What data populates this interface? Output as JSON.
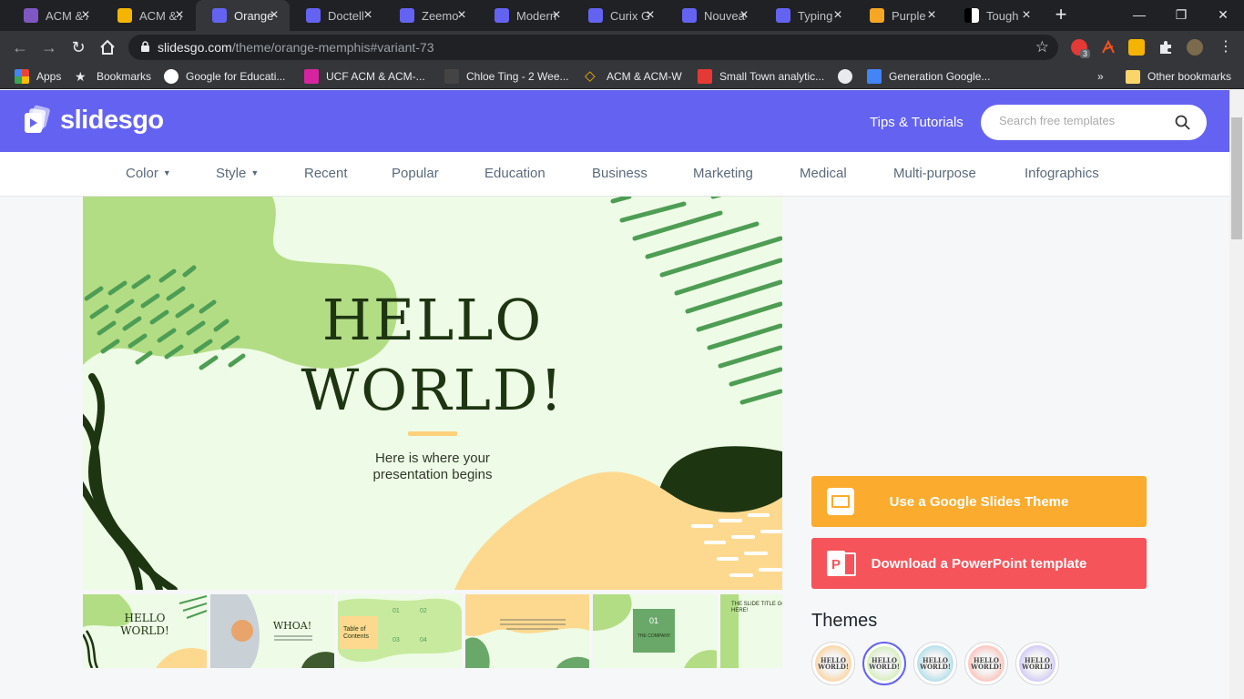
{
  "browser": {
    "tabs": [
      {
        "label": "ACM & ACM-W",
        "icon": "google-forms-icon",
        "color": "#7e57c2"
      },
      {
        "label": "ACM & ACM-W",
        "icon": "google-slides-icon",
        "color": "#f4b400"
      },
      {
        "label": "Orange Memphis",
        "icon": "slidesgo-icon",
        "color": "#6463f1",
        "active": true
      },
      {
        "label": "Doctell",
        "icon": "slidesgo-icon",
        "color": "#6463f1"
      },
      {
        "label": "Zeemo",
        "icon": "slidesgo-icon",
        "color": "#6463f1"
      },
      {
        "label": "Modern",
        "icon": "slidesgo-icon",
        "color": "#6463f1"
      },
      {
        "label": "Curix G",
        "icon": "slidesgo-icon",
        "color": "#6463f1"
      },
      {
        "label": "Nouveau",
        "icon": "slidesgo-icon",
        "color": "#6463f1"
      },
      {
        "label": "Typing",
        "icon": "slidesgo-icon",
        "color": "#6463f1"
      },
      {
        "label": "Purple",
        "icon": "orange-square-icon",
        "color": "#f6a623"
      },
      {
        "label": "Tough",
        "icon": "black-white-icon",
        "color": "#ffffff"
      }
    ],
    "url_host": "slidesgo.com",
    "url_path": "/theme/orange-memphis#variant-73",
    "bookmarks": [
      {
        "label": "Apps",
        "icon": "apps-grid-icon"
      },
      {
        "label": "Bookmarks",
        "icon": "star-icon"
      },
      {
        "label": "Google for Educati...",
        "icon": "google-icon"
      },
      {
        "label": "UCF ACM & ACM-...",
        "icon": "instagram-icon"
      },
      {
        "label": "Chloe Ting - 2 Wee...",
        "icon": "profile-icon"
      },
      {
        "label": "ACM & ACM-W",
        "icon": "diamond-icon"
      },
      {
        "label": "Small Town analytic...",
        "icon": "store-icon"
      },
      {
        "label": "",
        "icon": "globe-icon"
      },
      {
        "label": "Generation Google...",
        "icon": "google-docs-icon"
      }
    ],
    "bookmarks_more": "»",
    "other_bookmarks": "Other bookmarks",
    "extension_badge": "3"
  },
  "site": {
    "logo": "slidesgo",
    "tips": "Tips & Tutorials",
    "search_placeholder": "Search free templates",
    "nav": [
      {
        "label": "Color",
        "dropdown": true
      },
      {
        "label": "Style",
        "dropdown": true
      },
      {
        "label": "Recent"
      },
      {
        "label": "Popular"
      },
      {
        "label": "Education"
      },
      {
        "label": "Business"
      },
      {
        "label": "Marketing"
      },
      {
        "label": "Medical"
      },
      {
        "label": "Multi-purpose"
      },
      {
        "label": "Infographics"
      }
    ]
  },
  "slide": {
    "title_line1": "HELLO",
    "title_line2": "WORLD!",
    "subtitle_line1": "Here is where your",
    "subtitle_line2": "presentation begins"
  },
  "thumbnails": [
    {
      "text": "HELLO WORLD!"
    },
    {
      "text": "WHOA!"
    },
    {
      "text": "Table of Contents",
      "numbers": [
        "01",
        "02",
        "03",
        "04"
      ]
    },
    {
      "text": "This is a quote. Words full of wisdom that someone important said and can make the reader get inspired."
    },
    {
      "text": "THE COMPANY",
      "number": "01"
    },
    {
      "text": "THE SLIDE TITLE GOES HERE!"
    }
  ],
  "actions": {
    "google_slides": "Use a Google Slides Theme",
    "powerpoint": "Download a PowerPoint template"
  },
  "themes": {
    "title": "Themes",
    "swatch_text": "HELLO WORLD!",
    "variants": [
      {
        "color": "#fbd7a8",
        "selected": false
      },
      {
        "color": "#d6efbe",
        "selected": true
      },
      {
        "color": "#b7e0ec",
        "selected": false
      },
      {
        "color": "#fbc7c0",
        "selected": false
      },
      {
        "color": "#d3cdf5",
        "selected": false
      }
    ]
  },
  "colors": {
    "brand": "#6463f1",
    "google_slides_btn": "#fbab2d",
    "powerpoint_btn": "#f5545a",
    "slide_bg": "#eefbe6",
    "slide_green": "#b3dd85",
    "slide_yellow": "#fdd990",
    "slide_dark": "#1e3512"
  }
}
